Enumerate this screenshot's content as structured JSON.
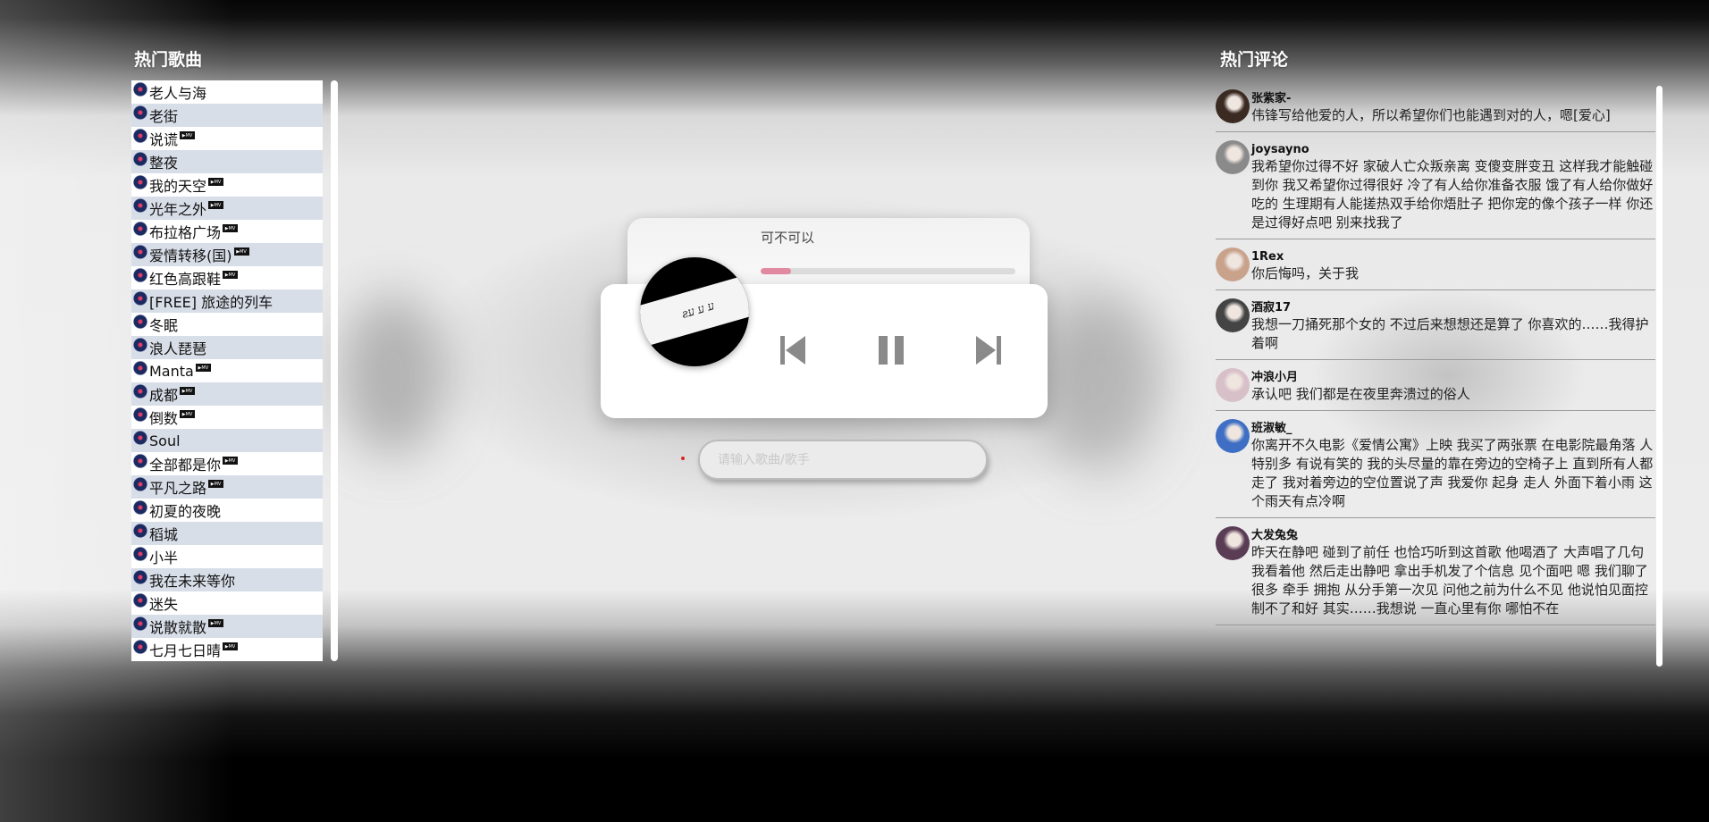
{
  "left_panel": {
    "title": "热门歌曲",
    "songs": [
      {
        "name": "老人与海",
        "mv": false
      },
      {
        "name": "老街",
        "mv": false
      },
      {
        "name": "说谎",
        "mv": true
      },
      {
        "name": "整夜",
        "mv": false
      },
      {
        "name": "我的天空",
        "mv": true
      },
      {
        "name": "光年之外",
        "mv": true
      },
      {
        "name": "布拉格广场",
        "mv": true
      },
      {
        "name": "爱情转移(国)",
        "mv": true
      },
      {
        "name": "红色高跟鞋",
        "mv": true
      },
      {
        "name": "[FREE] 旅途的列车",
        "mv": false
      },
      {
        "name": "冬眠",
        "mv": false
      },
      {
        "name": "浪人琵琶",
        "mv": false
      },
      {
        "name": "Manta",
        "mv": true
      },
      {
        "name": "成都",
        "mv": true
      },
      {
        "name": "倒数",
        "mv": true
      },
      {
        "name": "Soul",
        "mv": false
      },
      {
        "name": "全部都是你",
        "mv": true
      },
      {
        "name": "平凡之路",
        "mv": true
      },
      {
        "name": "初夏的夜晚",
        "mv": false
      },
      {
        "name": "稻城",
        "mv": false
      },
      {
        "name": "小半",
        "mv": false
      },
      {
        "name": "我在未来等你",
        "mv": false
      },
      {
        "name": "迷失",
        "mv": false
      },
      {
        "name": "说散就散",
        "mv": true
      },
      {
        "name": "七月七日晴",
        "mv": true
      }
    ]
  },
  "player": {
    "song_name": "可不可以",
    "progress": 0.12,
    "album_art_text": "ƨע ע ע",
    "icons": {
      "prev": "skip-previous-icon",
      "pause": "pause-icon",
      "next": "skip-next-icon"
    },
    "accent_color": "#e38aa3"
  },
  "search": {
    "placeholder": "请输入歌曲/歌手",
    "value": ""
  },
  "right_panel": {
    "title": "热门评论",
    "comments": [
      {
        "user": "张紫家-",
        "text": "伟锋写给他爱的人，所以希望你们也能遇到对的人，嗯[爱心]",
        "avatar_color": "#3a2a22"
      },
      {
        "user": "joysayno",
        "text": "我希望你过得不好 家破人亡众叛亲离 变傻变胖变丑 这样我才能触碰到你 我又希望你过得很好 冷了有人给你准备衣服 饿了有人给你做好吃的 生理期有人能搓热双手给你焐肚子 把你宠的像个孩子一样 你还是过得好点吧 别来找我了",
        "avatar_color": "#8a8a8a"
      },
      {
        "user": "1Rex",
        "text": "你后悔吗，关于我",
        "avatar_color": "#c9a28c"
      },
      {
        "user": "酒寂17",
        "text": "我想一刀捅死那个女的 不过后来想想还是算了 你喜欢的……我得护着啊",
        "avatar_color": "#444444"
      },
      {
        "user": "冲浪小月",
        "text": "承认吧 我们都是在夜里奔溃过的俗人",
        "avatar_color": "#d8c0c8"
      },
      {
        "user": "班淑敏_",
        "text": "你离开不久电影《爱情公寓》上映 我买了两张票 在电影院最角落 人特别多 有说有笑的 我的头尽量的靠在旁边的空椅子上 直到所有人都走了 我对着旁边的空位置说了声 我爱你 起身 走人 外面下着小雨 这个雨天有点冷啊",
        "avatar_color": "#3f6fc4"
      },
      {
        "user": "大发兔兔",
        "text": "昨天在静吧 碰到了前任 也恰巧听到这首歌 他喝酒了 大声唱了几句 我看着他 然后走出静吧 拿出手机发了个信息 见个面吧 嗯 我们聊了很多 牵手 拥抱 从分手第一次见 问他之前为什么不见 他说怕见面控制不了和好 其实……我想说 一直心里有你 哪怕不在",
        "avatar_color": "#5a3c55"
      }
    ]
  }
}
